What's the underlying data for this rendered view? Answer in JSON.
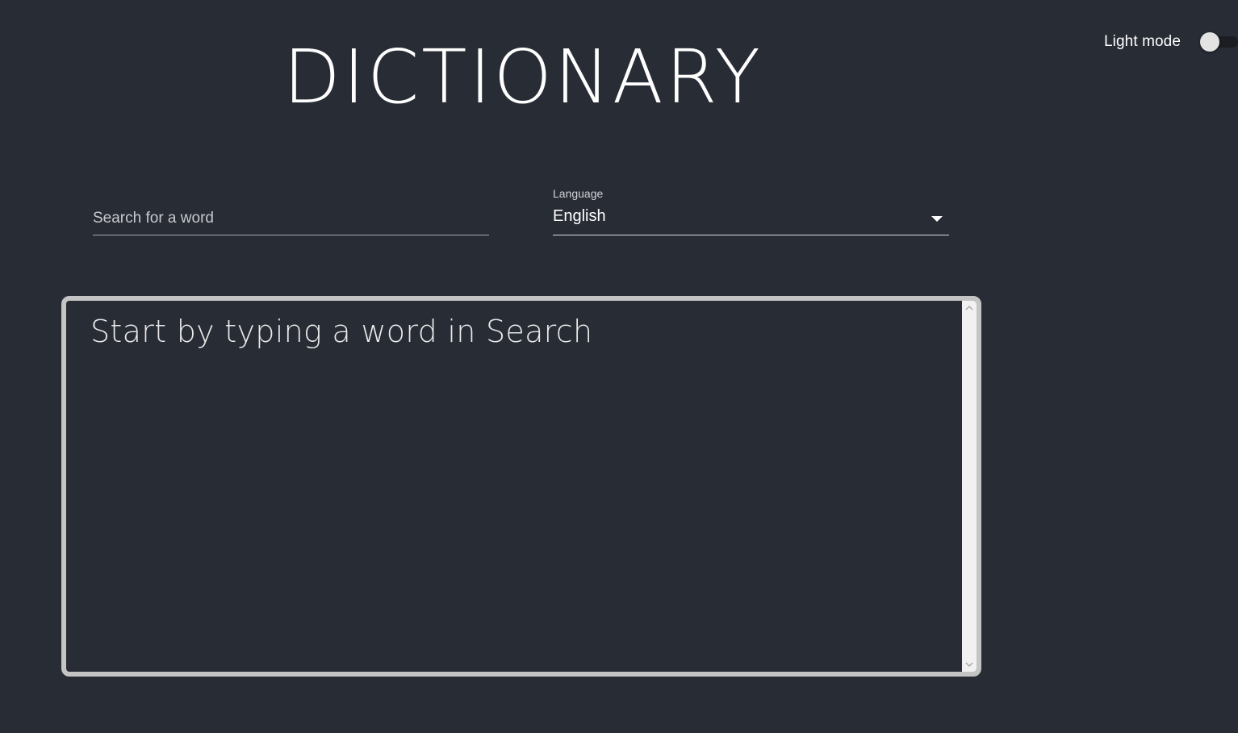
{
  "header": {
    "title": "DICTIONARY",
    "theme_toggle": {
      "label": "Light mode",
      "checked": false
    }
  },
  "search": {
    "value": "",
    "placeholder": "Search for a word"
  },
  "language": {
    "label": "Language",
    "selected": "English"
  },
  "results": {
    "placeholder_text": "Start by typing a word in Search"
  },
  "colors": {
    "background": "#282c35",
    "text": "#ffffff",
    "border": "#c4c4c4",
    "toggle_thumb": "#e3e3e3"
  },
  "icons": {
    "dropdown": "chevron-down-icon",
    "scroll_up": "chevron-up-icon",
    "scroll_down": "chevron-down-icon"
  }
}
